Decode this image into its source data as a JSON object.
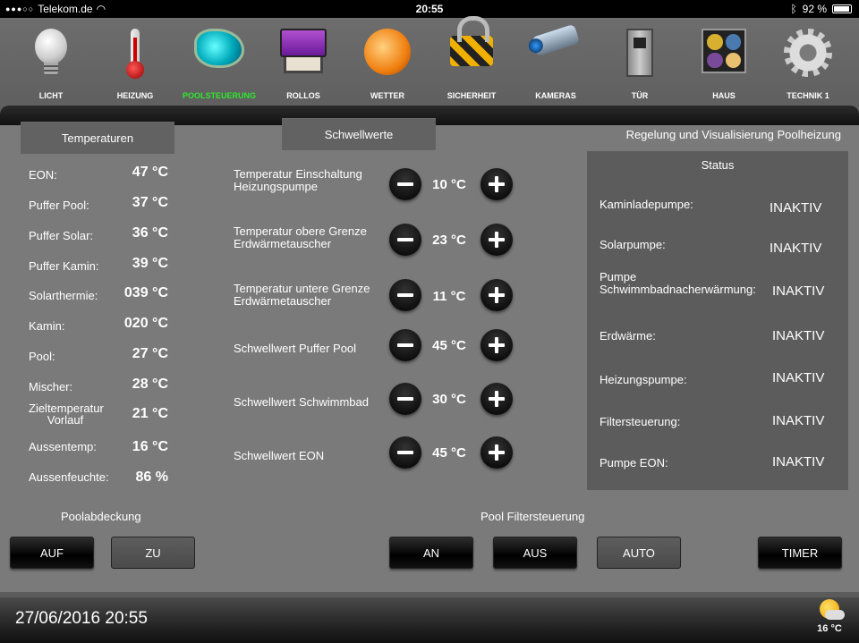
{
  "statusbar": {
    "carrier": "Telekom.de",
    "time": "20:55",
    "battery": "92 %"
  },
  "nav": {
    "items": [
      {
        "label": "LICHT",
        "icon": "light-bulb-icon"
      },
      {
        "label": "HEIZUNG",
        "icon": "thermometer-icon"
      },
      {
        "label": "POOLSTEUERUNG",
        "icon": "pool-icon",
        "active": true
      },
      {
        "label": "ROLLOS",
        "icon": "blinds-icon"
      },
      {
        "label": "WETTER",
        "icon": "weather-icon"
      },
      {
        "label": "SICHERHEIT",
        "icon": "padlock-icon"
      },
      {
        "label": "KAMERAS",
        "icon": "camera-icon"
      },
      {
        "label": "TÜR",
        "icon": "door-intercom-icon"
      },
      {
        "label": "HAUS",
        "icon": "house-icon"
      },
      {
        "label": "TECHNIK 1",
        "icon": "gear-icon"
      }
    ],
    "active_color": "#2ee82e"
  },
  "temperatures": {
    "title": "Temperaturen",
    "rows": [
      {
        "name": "EON:",
        "value": "47 °C"
      },
      {
        "name": "Puffer Pool:",
        "value": "37 °C"
      },
      {
        "name": "Puffer Solar:",
        "value": "36 °C"
      },
      {
        "name": "Puffer Kamin:",
        "value": "39 °C"
      },
      {
        "name": "Solarthermie:",
        "value": "039 °C"
      },
      {
        "name": "Kamin:",
        "value": "020 °C"
      },
      {
        "name": "Pool:",
        "value": "27 °C"
      },
      {
        "name": "Mischer:",
        "value": "28 °C"
      },
      {
        "name": "Zieltemperatur Vorlauf",
        "value": "21 °C"
      },
      {
        "name": "Aussentemp:",
        "value": "16 °C"
      },
      {
        "name": "Aussenfeuchte:",
        "value": "86 %"
      }
    ]
  },
  "thresholds": {
    "title": "Schwellwerte",
    "rows": [
      {
        "name": "Temperatur Einschaltung Heizungspumpe",
        "value": "10 °C"
      },
      {
        "name": "Temperatur obere Grenze Erdwärmetauscher",
        "value": "23 °C"
      },
      {
        "name": "Temperatur untere Grenze Erdwärmetauscher",
        "value": "11 °C"
      },
      {
        "name": "Schwellwert Puffer Pool",
        "value": "45 °C"
      },
      {
        "name": "Schwellwert Schwimmbad",
        "value": "30 °C"
      },
      {
        "name": "Schwellwert EON",
        "value": "45 °C"
      }
    ]
  },
  "status": {
    "heading": "Regelung und Visualisierung Poolheizung",
    "title": "Status",
    "rows": [
      {
        "name": "Kaminladepumpe:",
        "value": "INAKTIV"
      },
      {
        "name": "Solarpumpe:",
        "value": "INAKTIV"
      },
      {
        "name": "Pumpe Schwimmbadnacherwärmung:",
        "value": "INAKTIV"
      },
      {
        "name": "Erdwärme:",
        "value": "INAKTIV"
      },
      {
        "name": "Heizungspumpe:",
        "value": "INAKTIV"
      },
      {
        "name": "Filtersteuerung:",
        "value": "INAKTIV"
      },
      {
        "name": "Pumpe EON:",
        "value": "INAKTIV"
      }
    ]
  },
  "pool_cover": {
    "title": "Poolabdeckung",
    "open_label": "AUF",
    "close_label": "ZU"
  },
  "filter": {
    "title": "Pool Filtersteuerung",
    "on_label": "AN",
    "off_label": "AUS",
    "auto_label": "AUTO",
    "timer_label": "TIMER"
  },
  "footer": {
    "datetime": "27/06/2016 20:55",
    "weather_temp": "16 °C",
    "weather_icon": "partly-cloudy-icon"
  }
}
